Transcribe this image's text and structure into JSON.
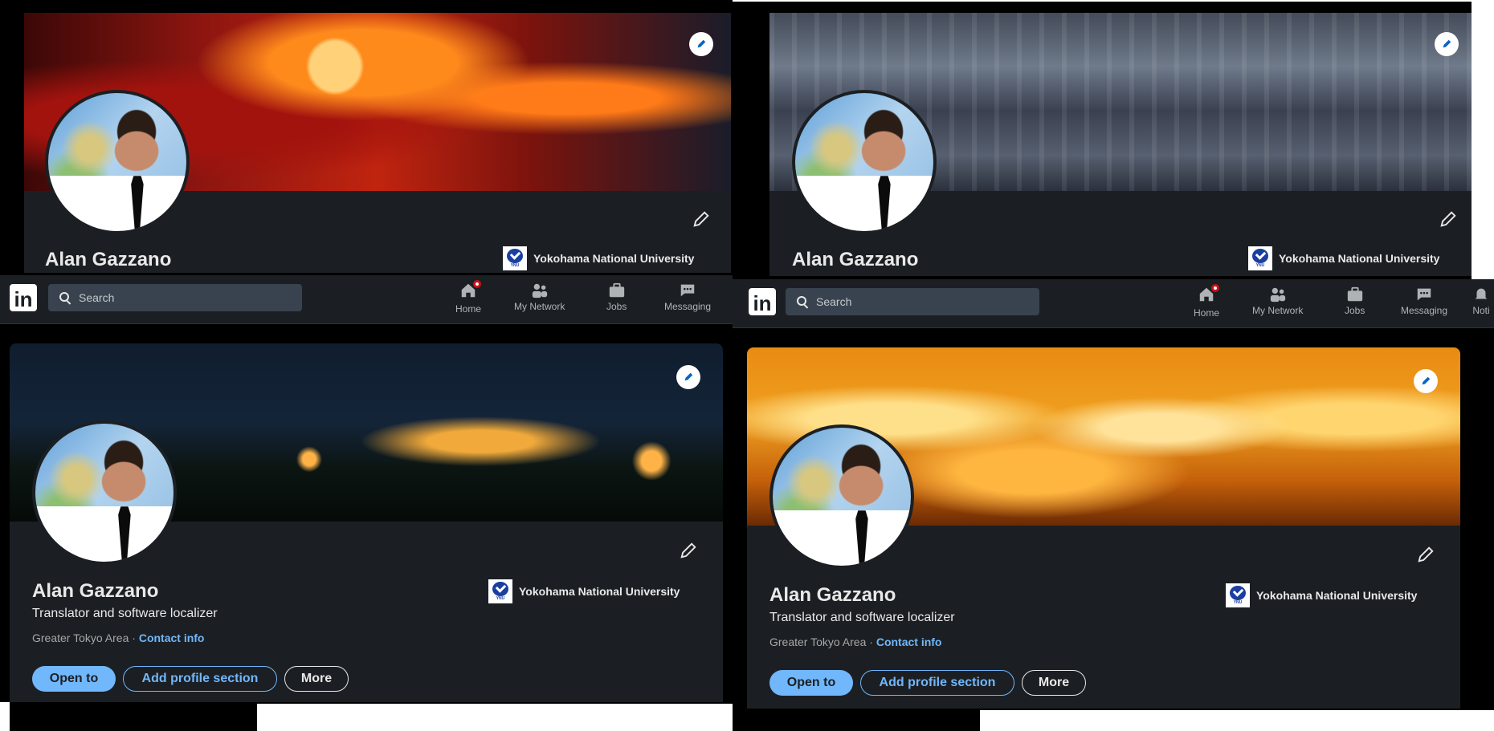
{
  "profile": {
    "name": "Alan Gazzano",
    "headline": "Translator and software localizer",
    "location": "Greater Tokyo Area",
    "separator": "·",
    "contact_link": "Contact info",
    "school": "Yokohama National University",
    "school_logo_text": "YNU"
  },
  "actions": {
    "open_to": "Open to",
    "add_section": "Add profile section",
    "more": "More"
  },
  "nav": {
    "logo": "in",
    "search_placeholder": "Search",
    "items": [
      "Home",
      "My Network",
      "Jobs",
      "Messaging",
      "Noti"
    ]
  },
  "colors": {
    "card_bg": "#1b1f23",
    "accent": "#71b7fb",
    "badge": "#cc1016"
  }
}
